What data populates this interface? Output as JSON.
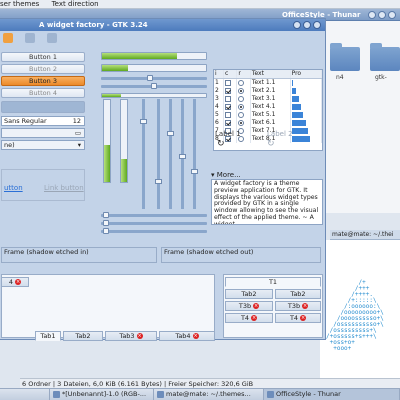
{
  "desktop": {
    "top_menu": [
      "ser themes",
      "Text direction"
    ],
    "thunar": {
      "title": "OfficeStyle - Thunar",
      "folders": [
        {
          "label": "n4"
        },
        {
          "label": "gtk-"
        }
      ],
      "status": "6 Ordner  |  3 Dateien, 6,0 KiB (6.161 Bytes)  |  Freier Speicher: 320,6 GiB"
    },
    "terminal": {
      "title": "mate@mate: ~/.thei",
      "art": "         /+\n        /+++\n       /++++.\n      /+:::::\\\n     /:oooooo:\\\n    /ooooooooo+\\\n   /oooossssso+\\\n  /ossssssssso+\\\n /osssssssss+\\\n/+osssss+s+++\\\n +oss+o+\n  +ooo+"
    },
    "taskbar": [
      {
        "label": "",
        "active": false
      },
      {
        "label": "*[Unbenannt]-1.0 (RGB-...",
        "active": false
      },
      {
        "label": "mate@mate: ~/.themes...",
        "active": false
      },
      {
        "label": "OfficeStyle - Thunar",
        "active": true
      }
    ]
  },
  "widget_factory": {
    "title": "A widget factory - GTK 3.24",
    "buttons": [
      "Button 1",
      "Button 2",
      "Button 3",
      "Button 4"
    ],
    "font_button": {
      "name": "Sans Regular",
      "size": "12"
    },
    "combo_value": "ne)",
    "link_buttons": [
      "utton",
      "Link button"
    ],
    "progress": [
      0.72,
      0.25,
      0.18
    ],
    "hscales": [
      0.55,
      0.5
    ],
    "vertical": {
      "progress": [
        0.45,
        0.28
      ],
      "scales": [
        0.82,
        0.7,
        0.5,
        0.35
      ]
    },
    "list": {
      "headers": [
        "i",
        "c",
        "r",
        "Text",
        "Pro"
      ],
      "rows": [
        {
          "i": "1",
          "c": false,
          "r": false,
          "text": "Text 1.1",
          "progress": 0.05
        },
        {
          "i": "2",
          "c": true,
          "r": true,
          "text": "Text 2.1",
          "progress": 0.25
        },
        {
          "i": "3",
          "c": false,
          "r": false,
          "text": "Text 3.1",
          "progress": 0.4
        },
        {
          "i": "4",
          "c": true,
          "r": true,
          "text": "Text 4.1",
          "progress": 0.55
        },
        {
          "i": "5",
          "c": false,
          "r": false,
          "text": "Text 5.1",
          "progress": 0.65
        },
        {
          "i": "6",
          "c": true,
          "r": true,
          "text": "Text 6.1",
          "progress": 0.8
        },
        {
          "i": "7",
          "c": false,
          "r": false,
          "text": "Text 7.1",
          "progress": 0.9
        },
        {
          "i": "8",
          "c": true,
          "r": false,
          "text": "Text 8.1",
          "progress": 1.0
        }
      ]
    },
    "labels": [
      "Label 1",
      "Label 2"
    ],
    "expander": "More...",
    "text_view": "A widget factory is a theme preview application for GTK. It displays the various widget types provided by GTK in a single window allowing to see the visual effect of the applied theme. ~ A widget",
    "frames": [
      "Frame (shadow etched in)",
      "Frame (shadow etched out)"
    ],
    "tabs_left": [
      "Tab1",
      "Tab2",
      "Tab3",
      "Tab4"
    ],
    "tab_side": "4",
    "tabs_right_top": "T1",
    "tabs_right": [
      "Tab2",
      "T3b",
      "T4"
    ],
    "colors": {
      "accent": "#ec8a2a",
      "selection": "#3b84d8",
      "progress": "#5faa1f"
    }
  }
}
